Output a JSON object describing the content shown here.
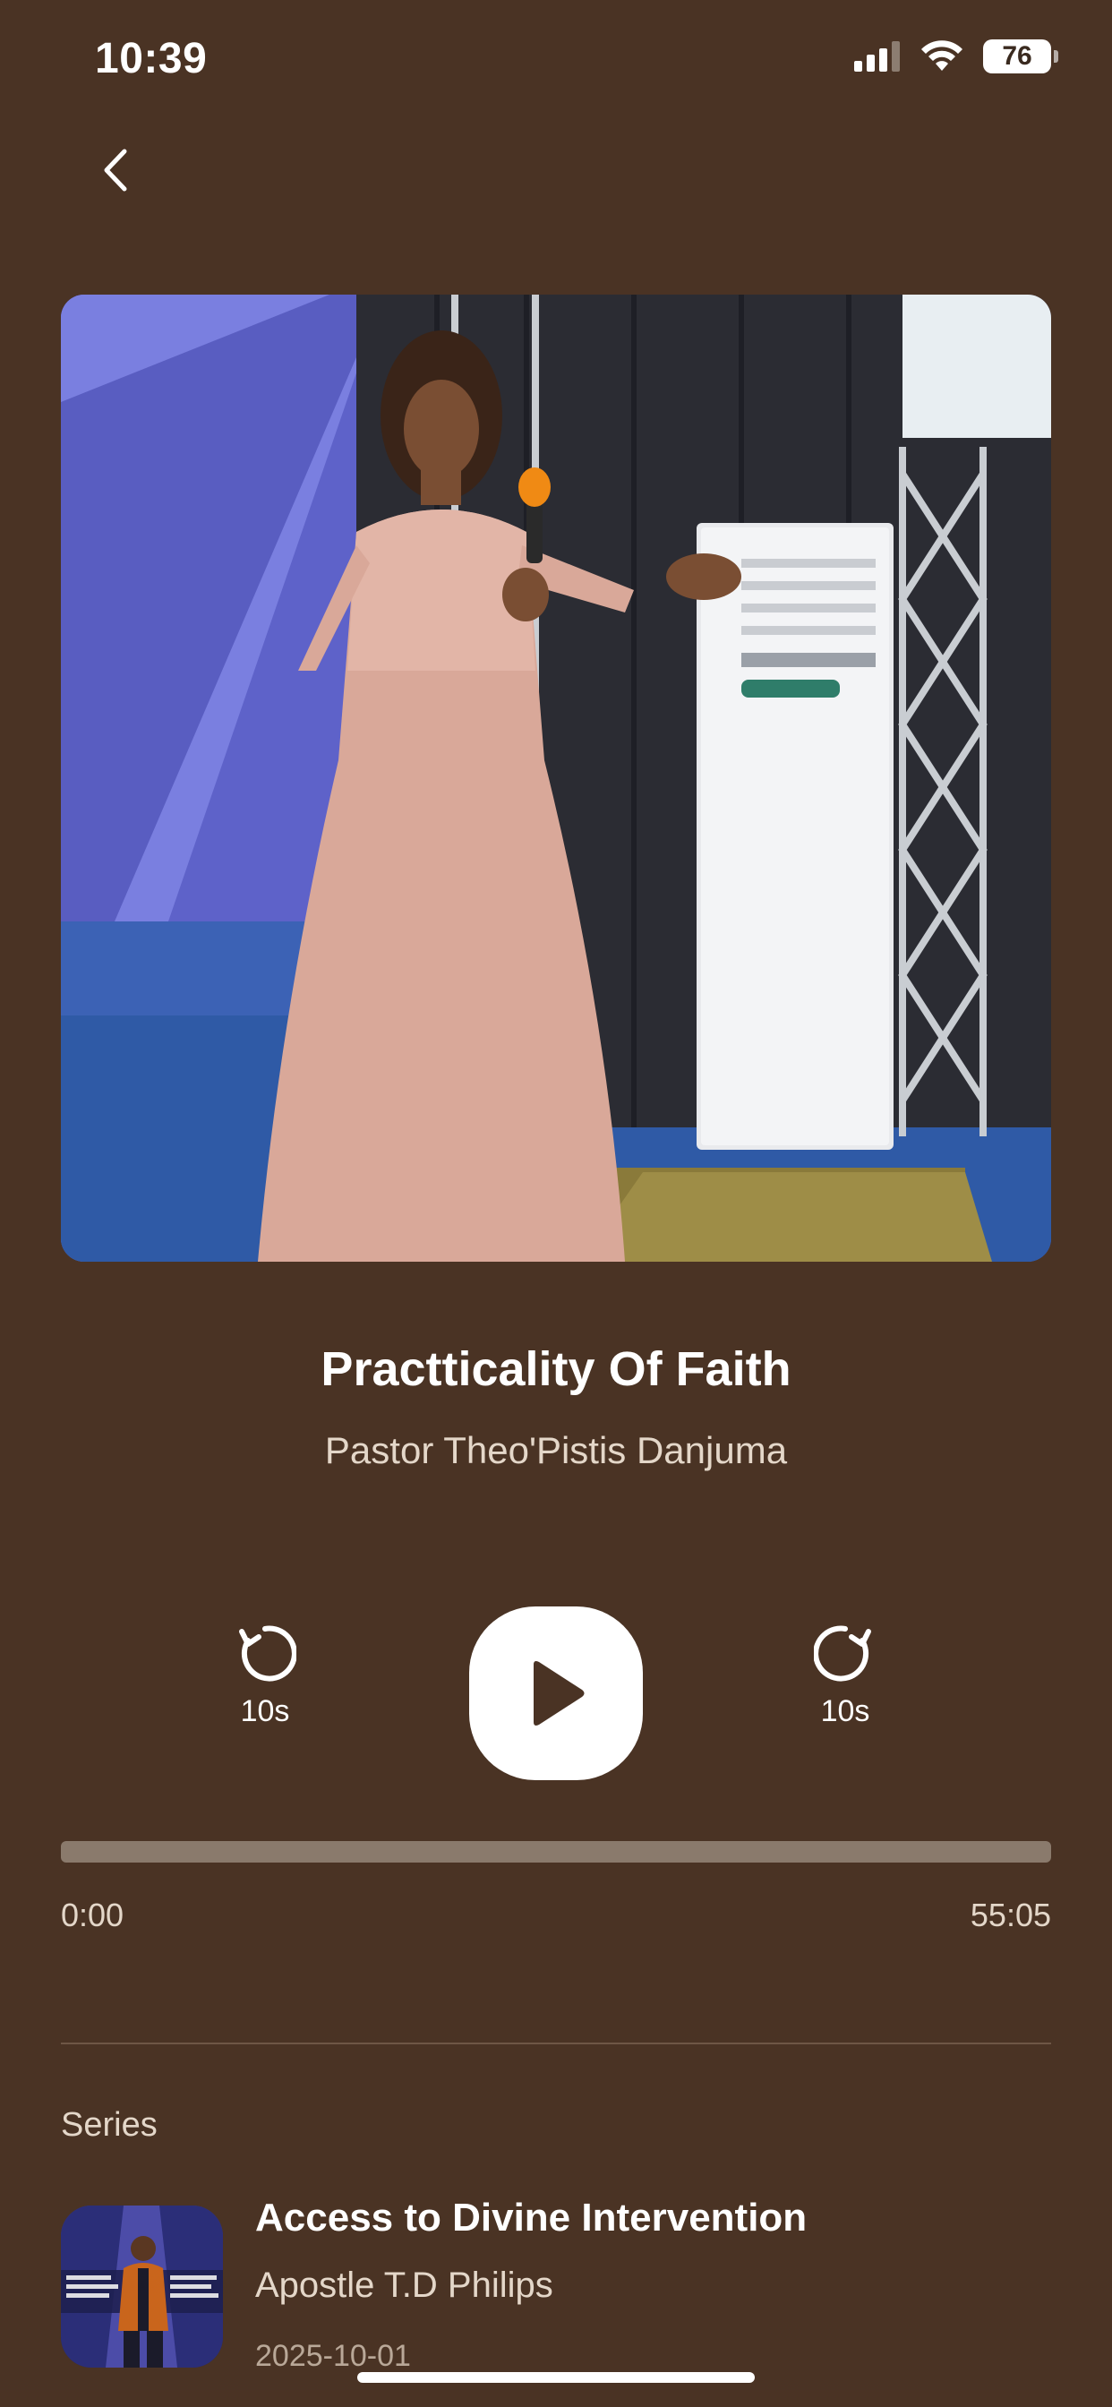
{
  "status_bar": {
    "time": "10:39",
    "battery": "76"
  },
  "now_playing": {
    "title": "Practticality Of Faith",
    "artist": "Pastor Theo'Pistis Danjuma"
  },
  "controls": {
    "rewind_label": "10s",
    "forward_label": "10s",
    "play_icon": "play-icon"
  },
  "progress": {
    "current": "0:00",
    "duration": "55:05",
    "fraction": 0
  },
  "series": {
    "heading": "Series",
    "items": [
      {
        "title": "Access to Divine Intervention",
        "artist": "Apostle T.D Philips",
        "date": "2025-10-01"
      }
    ]
  },
  "colors": {
    "background": "#4a3324",
    "progress_track": "#8a7a6c",
    "secondary_text": "#e4d7c9"
  }
}
